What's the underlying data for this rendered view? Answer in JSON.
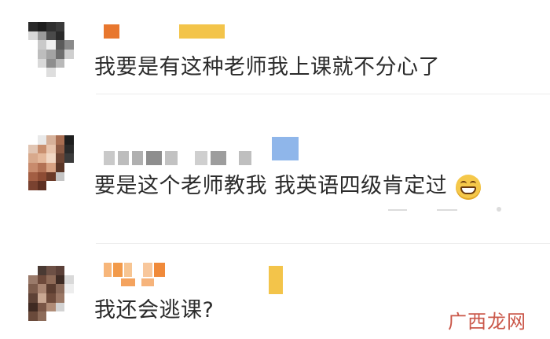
{
  "comments": [
    {
      "text": "我要是有这种老师我上课就不分心了",
      "has_emoji": false
    },
    {
      "text": "要是这个老师教我 我英语四级肯定过",
      "has_emoji": true,
      "emoji_icon": "grinning-face-icon"
    },
    {
      "text": "我还会逃课?",
      "has_emoji": false
    }
  ],
  "watermark": "广西龙网",
  "colors": {
    "text": "#2b2b2b",
    "divider": "#ececec",
    "watermark": "#c13a2a",
    "name_orange": "#e8772e",
    "name_yellow": "#f3c44a",
    "name_blue": "#8fb6ea",
    "name_gray": "#bfbfbf"
  }
}
